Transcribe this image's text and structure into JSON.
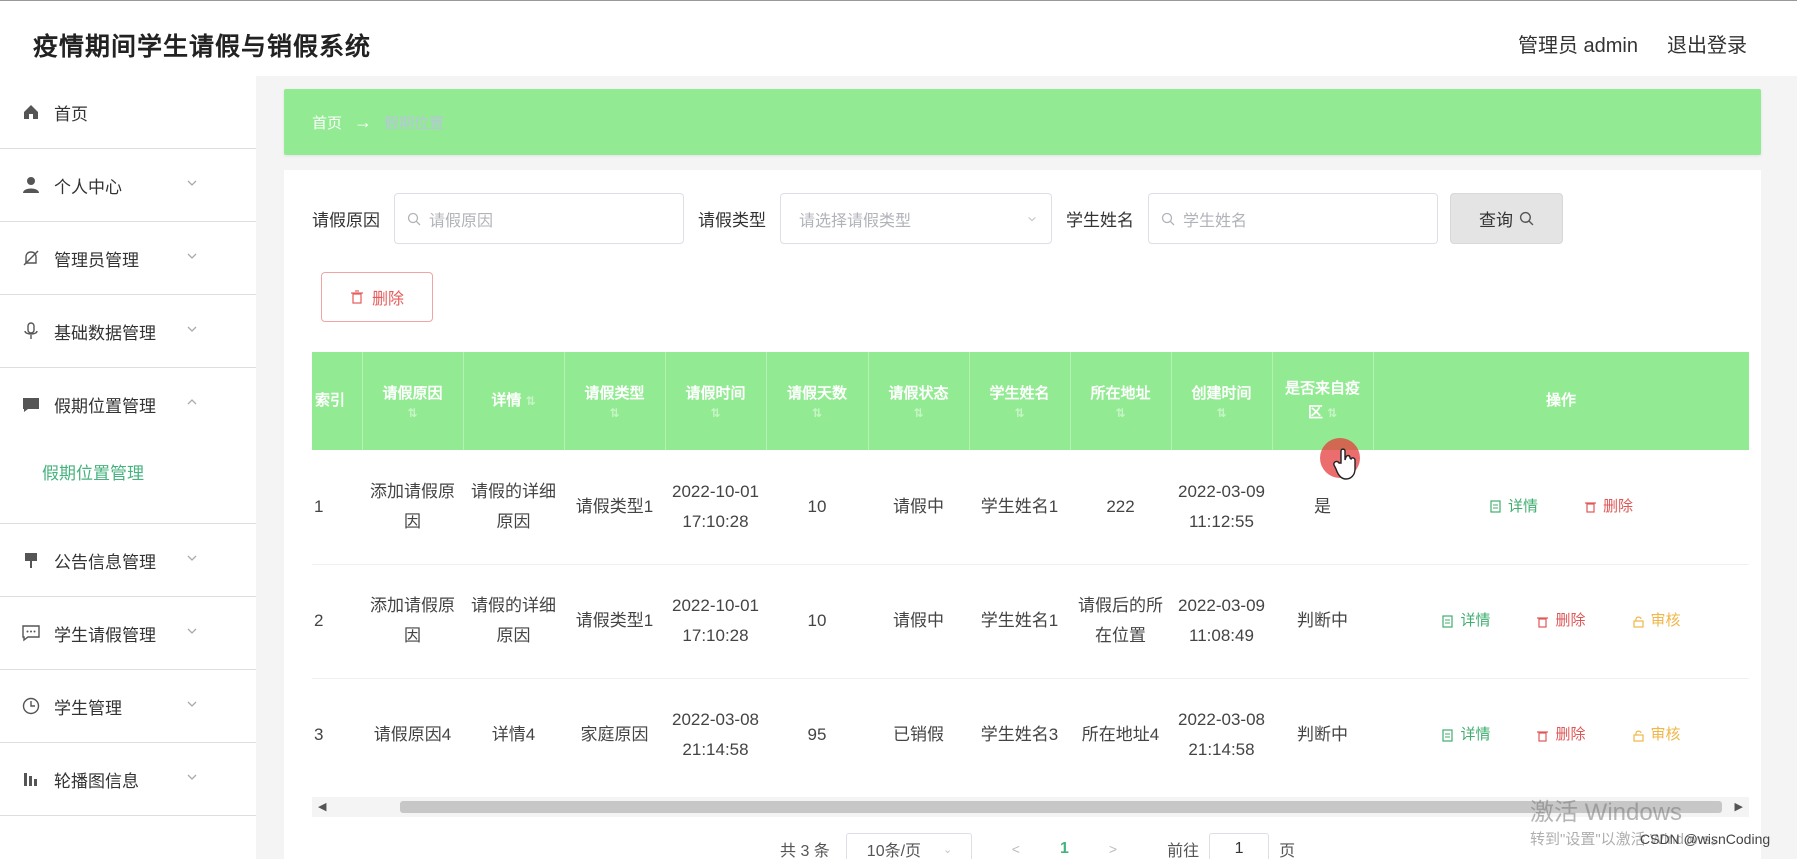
{
  "header": {
    "title": "疫情期间学生请假与销假系统",
    "admin": "管理员 admin",
    "logout": "退出登录"
  },
  "sidebar": {
    "items": [
      {
        "label": "首页",
        "icon": "home-icon"
      },
      {
        "label": "个人中心",
        "icon": "user-icon"
      },
      {
        "label": "管理员管理",
        "icon": "bell-off-icon"
      },
      {
        "label": "基础数据管理",
        "icon": "microphone-icon"
      },
      {
        "label": "假期位置管理",
        "icon": "chat-bubble-icon"
      },
      {
        "label": "公告信息管理",
        "icon": "pin-icon"
      },
      {
        "label": "学生请假管理",
        "icon": "message-icon"
      },
      {
        "label": "学生管理",
        "icon": "clock-icon"
      },
      {
        "label": "轮播图信息",
        "icon": "chart-icon"
      }
    ],
    "submenu": {
      "label": "假期位置管理"
    }
  },
  "breadcrumb": {
    "home": "首页",
    "arrow": "→",
    "current": "假期位置"
  },
  "search": {
    "reason_label": "请假原因",
    "reason_placeholder": "请假原因",
    "type_label": "请假类型",
    "type_placeholder": "请选择请假类型",
    "name_label": "学生姓名",
    "name_placeholder": "学生姓名",
    "query_label": "查询"
  },
  "toolbar": {
    "delete_label": "删除"
  },
  "table": {
    "headers": [
      "索引",
      "请假原因",
      "详情",
      "请假类型",
      "请假时间",
      "请假天数",
      "请假状态",
      "学生姓名",
      "所在地址",
      "创建时间",
      "是否来自疫区",
      "操作"
    ],
    "rows": [
      {
        "index": "1",
        "reason": "添加请假原因",
        "detail": "请假的详细原因",
        "type": "请假类型1",
        "time": "2022-10-01 17:10:28",
        "days": "10",
        "status": "请假中",
        "name": "学生姓名1",
        "address": "222",
        "created": "2022-03-09 11:12:55",
        "from_zone": "是"
      },
      {
        "index": "2",
        "reason": "添加请假原因",
        "detail": "请假的详细原因",
        "type": "请假类型1",
        "time": "2022-10-01 17:10:28",
        "days": "10",
        "status": "请假中",
        "name": "学生姓名1",
        "address": "请假后的所在位置",
        "created": "2022-03-09 11:08:49",
        "from_zone": "判断中"
      },
      {
        "index": "3",
        "reason": "请假原因4",
        "detail": "详情4",
        "type": "家庭原因",
        "time": "2022-03-08 21:14:58",
        "days": "95",
        "status": "已销假",
        "name": "学生姓名3",
        "address": "所在地址4",
        "created": "2022-03-08 21:14:58",
        "from_zone": "判断中"
      }
    ],
    "ops": {
      "detail": "详情",
      "delete": "删除",
      "audit": "审核"
    }
  },
  "pagination": {
    "total": "共 3 条",
    "page_size": "10条/页",
    "current": "1",
    "goto": "前往",
    "goto_value": "1",
    "page_unit": "页"
  },
  "watermark": {
    "line1": "激活 Windows",
    "line2": "转到\"设置\"以激活 Windows。",
    "csdn": "CSDN @wisnCoding"
  },
  "colors": {
    "accent_green": "#92eb92",
    "link_green": "#46b37e",
    "danger": "#e05656",
    "warning": "#f0b648"
  }
}
